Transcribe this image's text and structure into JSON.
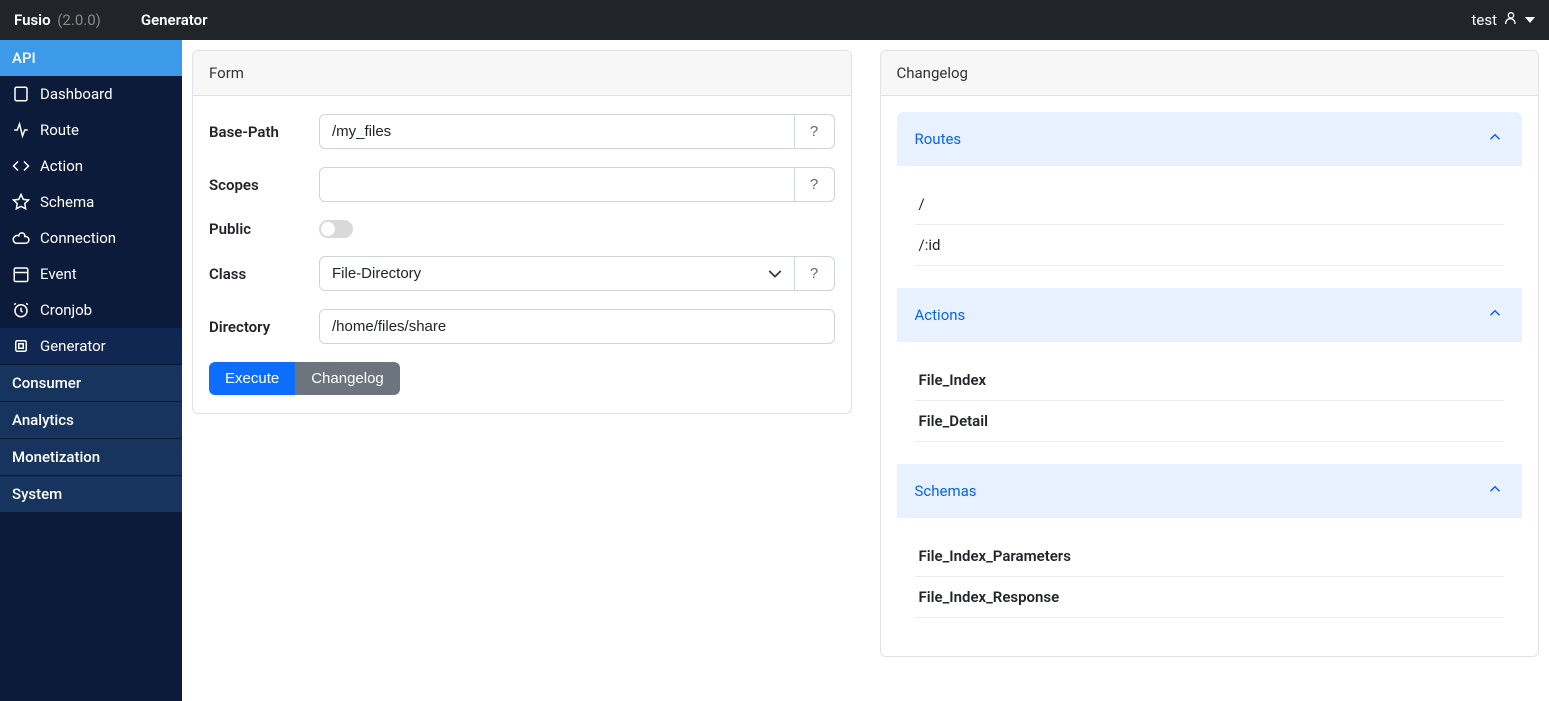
{
  "brand": {
    "name": "Fusio",
    "version": "(2.0.0)"
  },
  "page_title": "Generator",
  "user": {
    "name": "test"
  },
  "sidebar": {
    "sections": [
      {
        "label": "API",
        "active": true,
        "items": [
          {
            "label": "Dashboard",
            "icon": "dashboard"
          },
          {
            "label": "Route",
            "icon": "route"
          },
          {
            "label": "Action",
            "icon": "code"
          },
          {
            "label": "Schema",
            "icon": "star"
          },
          {
            "label": "Connection",
            "icon": "cloud"
          },
          {
            "label": "Event",
            "icon": "calendar"
          },
          {
            "label": "Cronjob",
            "icon": "clock"
          },
          {
            "label": "Generator",
            "icon": "cpu",
            "active": true
          }
        ]
      },
      {
        "label": "Consumer",
        "collapsed": true
      },
      {
        "label": "Analytics",
        "collapsed": true
      },
      {
        "label": "Monetization",
        "collapsed": true
      },
      {
        "label": "System",
        "collapsed": true
      }
    ]
  },
  "form": {
    "title": "Form",
    "labels": {
      "base_path": "Base-Path",
      "scopes": "Scopes",
      "public": "Public",
      "class": "Class",
      "directory": "Directory"
    },
    "values": {
      "base_path": "/my_files",
      "scopes": "",
      "public": false,
      "class": "File-Directory",
      "directory": "/home/files/share"
    },
    "help_label": "?",
    "buttons": {
      "execute": "Execute",
      "changelog": "Changelog"
    }
  },
  "changelog": {
    "title": "Changelog",
    "sections": [
      {
        "title": "Routes",
        "items": [
          "/",
          "/:id"
        ],
        "bold": false
      },
      {
        "title": "Actions",
        "items": [
          "File_Index",
          "File_Detail"
        ],
        "bold": true
      },
      {
        "title": "Schemas",
        "items": [
          "File_Index_Parameters",
          "File_Index_Response"
        ],
        "bold": true
      }
    ]
  }
}
